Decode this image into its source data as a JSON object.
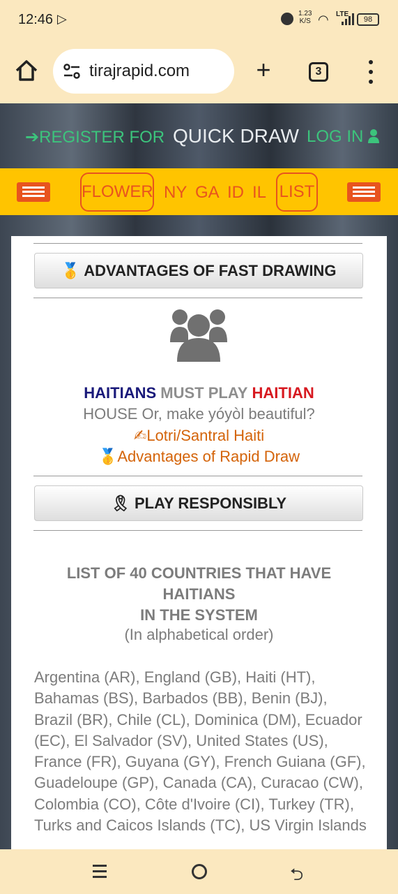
{
  "status_bar": {
    "time": "12:46",
    "speed_value": "1.23",
    "speed_unit": "K/S",
    "network": "LTE",
    "battery": "98"
  },
  "browser": {
    "url": "tirajrapid.com",
    "tab_count": "3",
    "icons": [
      "home-icon",
      "site-settings-icon",
      "plus-icon",
      "tabs-icon",
      "menu-icon"
    ]
  },
  "site_header": {
    "register": "REGISTER FOR",
    "title": "QUICK DRAW",
    "login": "LOG IN"
  },
  "nav": {
    "flower": "FLOWER",
    "ny": "NY",
    "ga": "GA",
    "id": "ID",
    "il": "IL",
    "list": "LIST"
  },
  "content": {
    "advantages_button": "🥇 ADVANTAGES OF FAST DRAWING",
    "haitians": "HAITIANS",
    "must_play": "MUST PLAY",
    "haitian": "HAITIAN",
    "house_line": "HOUSE Or, make yóyòl beautiful?",
    "lotri_link": "✍Lotri/Santral Haiti",
    "advantages_link": "🥇Advantages of Rapid Draw",
    "play_button": "🎗 PLAY RESPONSIBLY",
    "list_heading_1": "LIST OF 40 COUNTRIES THAT HAVE",
    "list_heading_2": "HAITIANS",
    "list_heading_3": "IN THE SYSTEM",
    "list_sub": "(In alphabetical order)",
    "countries": "Argentina (AR), England (GB), Haiti (HT), Bahamas (BS), Barbados (BB), Benin (BJ), Brazil (BR), Chile (CL), Dominica (DM), Ecuador (EC), El Salvador (SV), United States (US), France (FR), Guyana (GY), French Guiana (GF), Guadeloupe (GP), Canada (CA), Curacao (CW), Colombia (CO), Côte d'Ivoire (CI), Turkey (TR), Turks and Caicos Islands (TC), US Virgin Islands"
  },
  "colors": {
    "status_bg": "#fbe8bf",
    "header_green": "#3cc47c",
    "nav_yellow": "#ffc400",
    "nav_orange": "#e8541e",
    "haitians_blue": "#1a1a7a",
    "haitian_red": "#d71920",
    "link_orange": "#d4640a",
    "text_gray": "#7c7c7c"
  }
}
